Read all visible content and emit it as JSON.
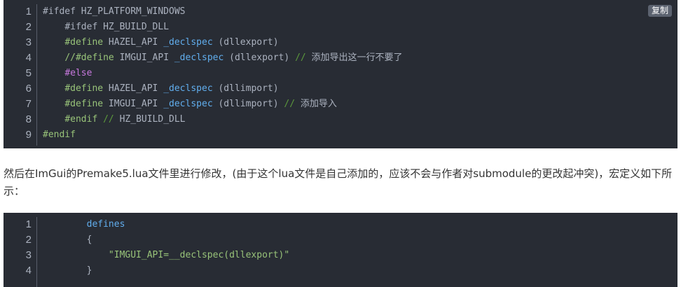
{
  "block1": {
    "copy_label": "复制",
    "line_numbers": [
      "1",
      "2",
      "3",
      "4",
      "5",
      "6",
      "7",
      "8",
      "9"
    ],
    "lines": [
      [
        {
          "t": "#ifdef HZ_PLATFORM_WINDOWS",
          "c": "tok-plain"
        }
      ],
      [
        {
          "t": "    ",
          "c": "tok-plain"
        },
        {
          "t": "#ifdef HZ_BUILD_DLL",
          "c": "tok-plain"
        }
      ],
      [
        {
          "t": "    ",
          "c": "tok-plain"
        },
        {
          "t": "#define",
          "c": "tok-pp"
        },
        {
          "t": " HAZEL_API ",
          "c": "tok-plain"
        },
        {
          "t": "_declspec",
          "c": "tok-fn"
        },
        {
          "t": " (dllexport)",
          "c": "tok-plain"
        }
      ],
      [
        {
          "t": "    ",
          "c": "tok-plain"
        },
        {
          "t": "//#define",
          "c": "tok-pp"
        },
        {
          "t": " IMGUI_API ",
          "c": "tok-plain"
        },
        {
          "t": "_declspec",
          "c": "tok-fn"
        },
        {
          "t": " (dllexport) ",
          "c": "tok-plain"
        },
        {
          "t": "// ",
          "c": "tok-cm"
        },
        {
          "t": "添加导出这一行不要了",
          "c": "tok-cm-text"
        }
      ],
      [
        {
          "t": "    ",
          "c": "tok-plain"
        },
        {
          "t": "#else",
          "c": "tok-kw"
        }
      ],
      [
        {
          "t": "    ",
          "c": "tok-plain"
        },
        {
          "t": "#define",
          "c": "tok-pp"
        },
        {
          "t": " HAZEL_API ",
          "c": "tok-plain"
        },
        {
          "t": "_declspec",
          "c": "tok-fn"
        },
        {
          "t": " (dllimport)",
          "c": "tok-plain"
        }
      ],
      [
        {
          "t": "    ",
          "c": "tok-plain"
        },
        {
          "t": "#define",
          "c": "tok-pp"
        },
        {
          "t": " IMGUI_API ",
          "c": "tok-plain"
        },
        {
          "t": "_declspec",
          "c": "tok-fn"
        },
        {
          "t": " (dllimport) ",
          "c": "tok-plain"
        },
        {
          "t": "// ",
          "c": "tok-cm"
        },
        {
          "t": "添加导入",
          "c": "tok-cm-text"
        }
      ],
      [
        {
          "t": "    ",
          "c": "tok-plain"
        },
        {
          "t": "#endif",
          "c": "tok-pp"
        },
        {
          "t": " ",
          "c": "tok-plain"
        },
        {
          "t": "//",
          "c": "tok-cm"
        },
        {
          "t": " HZ_BUILD_DLL",
          "c": "tok-plain"
        }
      ],
      [
        {
          "t": "#endif",
          "c": "tok-pp"
        }
      ]
    ]
  },
  "paragraph": "然后在ImGui的Premake5.lua文件里进行修改，(由于这个lua文件是自己添加的，应该不会与作者对submodule的更改起冲突)，宏定义如下所示：",
  "block2": {
    "line_numbers": [
      "1",
      "2",
      "3",
      "4"
    ],
    "lines": [
      [
        {
          "t": "        ",
          "c": "tok-plain"
        },
        {
          "t": "defines",
          "c": "tok-fn"
        }
      ],
      [
        {
          "t": "        ",
          "c": "tok-plain"
        },
        {
          "t": "{",
          "c": "tok-plain"
        }
      ],
      [
        {
          "t": "            ",
          "c": "tok-plain"
        },
        {
          "t": "\"IMGUI_API=__declspec(dllexport)\"",
          "c": "tok-str"
        }
      ],
      [
        {
          "t": "        ",
          "c": "tok-plain"
        },
        {
          "t": "}",
          "c": "tok-plain"
        }
      ]
    ]
  },
  "colors": {
    "code_background": "#282c34",
    "keyword": "#c678dd",
    "preprocessor": "#98c379",
    "function": "#61aeee",
    "comment": "#5c9a3c",
    "plain": "#abb2bf"
  }
}
